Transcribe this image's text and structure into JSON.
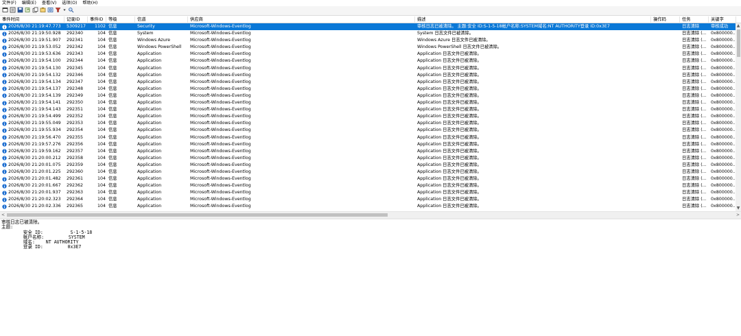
{
  "menu": [
    "文件(F)",
    "编辑(E)",
    "查看(V)",
    "选项(O)",
    "帮助(H)"
  ],
  "toolbar": [
    {
      "icon": "window-icon"
    },
    {
      "icon": "open-log-icon"
    },
    {
      "icon": "save-icon"
    },
    {
      "icon": "refresh-icon"
    },
    {
      "icon": "copy-icon"
    },
    {
      "icon": "properties-icon"
    },
    {
      "icon": "find-icon"
    },
    {
      "icon": "filter-icon"
    },
    {
      "icon": "dropdown-arrow-icon"
    },
    {
      "icon": "search-icon"
    }
  ],
  "columns": [
    "事件时间",
    "记录ID",
    "事件ID",
    "等级",
    "信道",
    "供应商",
    "描述",
    "操作码",
    "任务",
    "关键字"
  ],
  "rows": [
    {
      "time": "2026/8/30 21:19:47.773",
      "record": "5309217",
      "event": "1102",
      "level": "信息",
      "channel": "Security",
      "provider": "Microsoft-Windows-Eventlog",
      "desc": "审核日志已被清除。 主题:安全 ID:S-1-5-18帐户名称:SYSTEM域名:NT AUTHORITY登录 ID:0x3E7",
      "opcode": "",
      "task": "日志清除",
      "keyword": "审核成功",
      "selected": true
    },
    {
      "time": "2026/8/30 21:19:50.928",
      "record": "292340",
      "event": "104",
      "level": "信息",
      "channel": "System",
      "provider": "Microsoft-Windows-Eventlog",
      "desc": "System 日志文件已被清除。",
      "opcode": "",
      "task": "日志清除 (...",
      "keyword": "0x800000..."
    },
    {
      "time": "2026/8/30 21:19:51.907",
      "record": "292341",
      "event": "104",
      "level": "信息",
      "channel": "Windows Azure",
      "provider": "Microsoft-Windows-Eventlog",
      "desc": "Windows Azure 日志文件已被清除。",
      "opcode": "",
      "task": "日志清除 (...",
      "keyword": "0x800000..."
    },
    {
      "time": "2026/8/30 21:19:53.052",
      "record": "292342",
      "event": "104",
      "level": "信息",
      "channel": "Windows PowerShell",
      "provider": "Microsoft-Windows-Eventlog",
      "desc": "Windows PowerShell 日志文件已被清除。",
      "opcode": "",
      "task": "日志清除 (...",
      "keyword": "0x800000..."
    },
    {
      "time": "2026/8/30 21:19:53.636",
      "record": "292343",
      "event": "104",
      "level": "信息",
      "channel": "Application",
      "provider": "Microsoft-Windows-Eventlog",
      "desc": "Application 日志文件已被清除。",
      "opcode": "",
      "task": "日志清除 (...",
      "keyword": "0x800000..."
    },
    {
      "time": "2026/8/30 21:19:54.100",
      "record": "292344",
      "event": "104",
      "level": "信息",
      "channel": "Application",
      "provider": "Microsoft-Windows-Eventlog",
      "desc": "Application 日志文件已被清除。",
      "opcode": "",
      "task": "日志清除 (...",
      "keyword": "0x800000..."
    },
    {
      "time": "2026/8/30 21:19:54.130",
      "record": "292345",
      "event": "104",
      "level": "信息",
      "channel": "Application",
      "provider": "Microsoft-Windows-Eventlog",
      "desc": "Application 日志文件已被清除。",
      "opcode": "",
      "task": "日志清除 (...",
      "keyword": "0x800000..."
    },
    {
      "time": "2026/8/30 21:19:54.132",
      "record": "292346",
      "event": "104",
      "level": "信息",
      "channel": "Application",
      "provider": "Microsoft-Windows-Eventlog",
      "desc": "Application 日志文件已被清除。",
      "opcode": "",
      "task": "日志清除 (...",
      "keyword": "0x800000..."
    },
    {
      "time": "2026/8/30 21:19:54.134",
      "record": "292347",
      "event": "104",
      "level": "信息",
      "channel": "Application",
      "provider": "Microsoft-Windows-Eventlog",
      "desc": "Application 日志文件已被清除。",
      "opcode": "",
      "task": "日志清除 (...",
      "keyword": "0x800000..."
    },
    {
      "time": "2026/8/30 21:19:54.137",
      "record": "292348",
      "event": "104",
      "level": "信息",
      "channel": "Application",
      "provider": "Microsoft-Windows-Eventlog",
      "desc": "Application 日志文件已被清除。",
      "opcode": "",
      "task": "日志清除 (...",
      "keyword": "0x800000..."
    },
    {
      "time": "2026/8/30 21:19:54.139",
      "record": "292349",
      "event": "104",
      "level": "信息",
      "channel": "Application",
      "provider": "Microsoft-Windows-Eventlog",
      "desc": "Application 日志文件已被清除。",
      "opcode": "",
      "task": "日志清除 (...",
      "keyword": "0x800000..."
    },
    {
      "time": "2026/8/30 21:19:54.141",
      "record": "292350",
      "event": "104",
      "level": "信息",
      "channel": "Application",
      "provider": "Microsoft-Windows-Eventlog",
      "desc": "Application 日志文件已被清除。",
      "opcode": "",
      "task": "日志清除 (...",
      "keyword": "0x800000..."
    },
    {
      "time": "2026/8/30 21:19:54.143",
      "record": "292351",
      "event": "104",
      "level": "信息",
      "channel": "Application",
      "provider": "Microsoft-Windows-Eventlog",
      "desc": "Application 日志文件已被清除。",
      "opcode": "",
      "task": "日志清除 (...",
      "keyword": "0x800000..."
    },
    {
      "time": "2026/8/30 21:19:54.499",
      "record": "292352",
      "event": "104",
      "level": "信息",
      "channel": "Application",
      "provider": "Microsoft-Windows-Eventlog",
      "desc": "Application 日志文件已被清除。",
      "opcode": "",
      "task": "日志清除 (...",
      "keyword": "0x800000..."
    },
    {
      "time": "2026/8/30 21:19:55.049",
      "record": "292353",
      "event": "104",
      "level": "信息",
      "channel": "Application",
      "provider": "Microsoft-Windows-Eventlog",
      "desc": "Application 日志文件已被清除。",
      "opcode": "",
      "task": "日志清除 (...",
      "keyword": "0x800000..."
    },
    {
      "time": "2026/8/30 21:19:55.934",
      "record": "292354",
      "event": "104",
      "level": "信息",
      "channel": "Application",
      "provider": "Microsoft-Windows-Eventlog",
      "desc": "Application 日志文件已被清除。",
      "opcode": "",
      "task": "日志清除 (...",
      "keyword": "0x800000..."
    },
    {
      "time": "2026/8/30 21:19:56.470",
      "record": "292355",
      "event": "104",
      "level": "信息",
      "channel": "Application",
      "provider": "Microsoft-Windows-Eventlog",
      "desc": "Application 日志文件已被清除。",
      "opcode": "",
      "task": "日志清除 (...",
      "keyword": "0x800000..."
    },
    {
      "time": "2026/8/30 21:19:57.276",
      "record": "292356",
      "event": "104",
      "level": "信息",
      "channel": "Application",
      "provider": "Microsoft-Windows-Eventlog",
      "desc": "Application 日志文件已被清除。",
      "opcode": "",
      "task": "日志清除 (...",
      "keyword": "0x800000..."
    },
    {
      "time": "2026/8/30 21:19:59.162",
      "record": "292357",
      "event": "104",
      "level": "信息",
      "channel": "Application",
      "provider": "Microsoft-Windows-Eventlog",
      "desc": "Application 日志文件已被清除。",
      "opcode": "",
      "task": "日志清除 (...",
      "keyword": "0x800000..."
    },
    {
      "time": "2026/8/30 21:20:00.212",
      "record": "292358",
      "event": "104",
      "level": "信息",
      "channel": "Application",
      "provider": "Microsoft-Windows-Eventlog",
      "desc": "Application 日志文件已被清除。",
      "opcode": "",
      "task": "日志清除 (...",
      "keyword": "0x800000..."
    },
    {
      "time": "2026/8/30 21:20:01.075",
      "record": "292359",
      "event": "104",
      "level": "信息",
      "channel": "Application",
      "provider": "Microsoft-Windows-Eventlog",
      "desc": "Application 日志文件已被清除。",
      "opcode": "",
      "task": "日志清除 (...",
      "keyword": "0x800000..."
    },
    {
      "time": "2026/8/30 21:20:01.225",
      "record": "292360",
      "event": "104",
      "level": "信息",
      "channel": "Application",
      "provider": "Microsoft-Windows-Eventlog",
      "desc": "Application 日志文件已被清除。",
      "opcode": "",
      "task": "日志清除 (...",
      "keyword": "0x800000..."
    },
    {
      "time": "2026/8/30 21:20:01.482",
      "record": "292361",
      "event": "104",
      "level": "信息",
      "channel": "Application",
      "provider": "Microsoft-Windows-Eventlog",
      "desc": "Application 日志文件已被清除。",
      "opcode": "",
      "task": "日志清除 (...",
      "keyword": "0x800000..."
    },
    {
      "time": "2026/8/30 21:20:01.667",
      "record": "292362",
      "event": "104",
      "level": "信息",
      "channel": "Application",
      "provider": "Microsoft-Windows-Eventlog",
      "desc": "Application 日志文件已被清除。",
      "opcode": "",
      "task": "日志清除 (...",
      "keyword": "0x800000..."
    },
    {
      "time": "2026/8/30 21:20:01.937",
      "record": "292363",
      "event": "104",
      "level": "信息",
      "channel": "Application",
      "provider": "Microsoft-Windows-Eventlog",
      "desc": "Application 日志文件已被清除。",
      "opcode": "",
      "task": "日志清除 (...",
      "keyword": "0x800000..."
    },
    {
      "time": "2026/8/30 21:20:02.323",
      "record": "292364",
      "event": "104",
      "level": "信息",
      "channel": "Application",
      "provider": "Microsoft-Windows-Eventlog",
      "desc": "Application 日志文件已被清除。",
      "opcode": "",
      "task": "日志清除 (...",
      "keyword": "0x800000..."
    },
    {
      "time": "2026/8/30 21:20:02.336",
      "record": "292365",
      "event": "104",
      "level": "信息",
      "channel": "Application",
      "provider": "Microsoft-Windows-Eventlog",
      "desc": "Application 日志文件已被清除。",
      "opcode": "",
      "task": "日志清除 (...",
      "keyword": "0x800000..."
    }
  ],
  "scroll": {
    "up": "▲",
    "down": "▼",
    "left": "<",
    "right": ">"
  },
  "detail": [
    "审核日志已被清除。",
    "主题:",
    "        安全 ID:          S-1-5-18",
    "        帐户名称:         SYSTEM",
    "        域名:    NT AUTHORITY",
    "        登录 ID:         0x3E7"
  ],
  "colors": {
    "selected_row": "#0a78d7",
    "info_icon": "#1f6fd0"
  }
}
